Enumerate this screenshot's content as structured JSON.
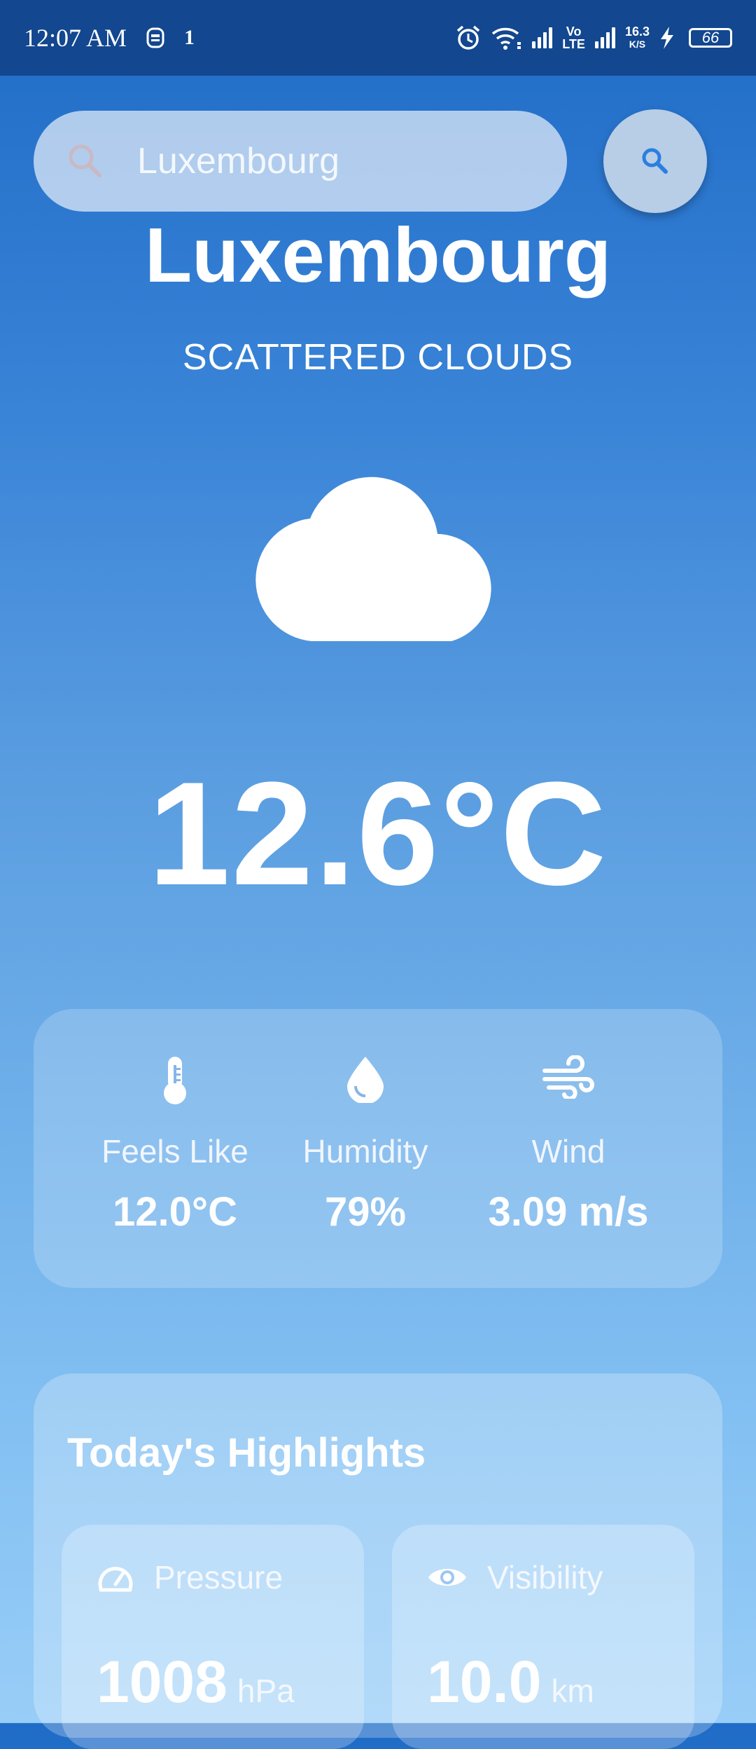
{
  "status_bar": {
    "time": "12:07 AM",
    "notif_count": "1",
    "net_speed_top": "16.3",
    "net_speed_bottom": "K/S",
    "volte_top": "Vo",
    "volte_bottom": "LTE",
    "battery": "66"
  },
  "search": {
    "placeholder": "Luxembourg"
  },
  "weather": {
    "city": "Luxembourg",
    "description": "SCATTERED CLOUDS",
    "temperature": "12.6°C"
  },
  "stats": [
    {
      "label": "Feels Like",
      "value": "12.0°C",
      "icon": "thermometer-icon"
    },
    {
      "label": "Humidity",
      "value": "79%",
      "icon": "water-drop-icon"
    },
    {
      "label": "Wind",
      "value": "3.09 m/s",
      "icon": "wind-icon"
    }
  ],
  "highlights": {
    "title": "Today's Highlights",
    "items": [
      {
        "label": "Pressure",
        "value": "1008",
        "unit": "hPa",
        "icon": "speedometer-icon"
      },
      {
        "label": "Visibility",
        "value": "10.0",
        "unit": "km",
        "icon": "eye-icon"
      }
    ]
  },
  "colors": {
    "status_bar": "#13478f",
    "gradient_top": "#1f6cc7",
    "gradient_bottom": "#98cdf7",
    "search_button_icon": "#2a7fe0"
  }
}
